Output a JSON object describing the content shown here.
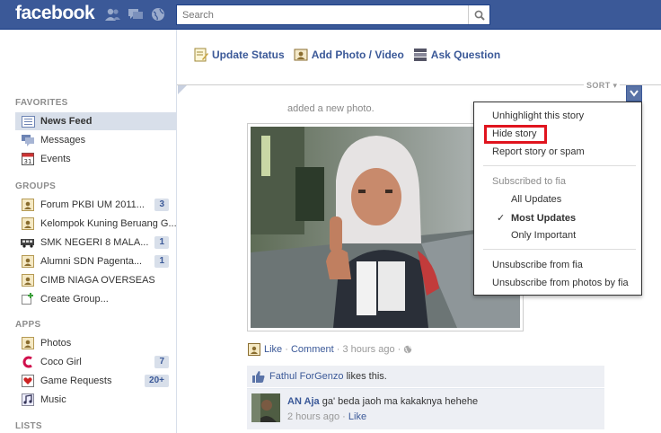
{
  "header": {
    "logo": "facebook",
    "search_placeholder": "Search"
  },
  "sidebar": {
    "favorites_title": "FAVORITES",
    "favorites": [
      {
        "label": "News Feed",
        "icon": "news-feed-icon",
        "selected": true
      },
      {
        "label": "Messages",
        "icon": "messages-icon"
      },
      {
        "label": "Events",
        "icon": "calendar-icon",
        "icon_text": "31"
      }
    ],
    "groups_title": "GROUPS",
    "groups": [
      {
        "label": "Forum PKBI UM 2011...",
        "badge": "3"
      },
      {
        "label": "Kelompok Kuning Beruang G...",
        "badge": ""
      },
      {
        "label": "SMK NEGERI 8 MALA...",
        "badge": "1"
      },
      {
        "label": "Alumni SDN Pagenta...",
        "badge": "1"
      },
      {
        "label": "CIMB NIAGA OVERSEAS",
        "badge": ""
      },
      {
        "label": "Create Group...",
        "badge": ""
      }
    ],
    "apps_title": "APPS",
    "apps": [
      {
        "label": "Photos",
        "badge": ""
      },
      {
        "label": "Coco Girl",
        "badge": "7"
      },
      {
        "label": "Game Requests",
        "badge": "20+"
      },
      {
        "label": "Music",
        "badge": ""
      }
    ],
    "lists_title": "LISTS"
  },
  "composer": {
    "update_status": "Update Status",
    "add_photo": "Add Photo / Video",
    "ask_question": "Ask Question"
  },
  "feed": {
    "sort_label": "SORT",
    "story_action": "added a new photo.",
    "like": "Like",
    "comment": "Comment",
    "sep": "·",
    "time": "3 hours ago",
    "liker": "Fathul ForGenzo",
    "likes_suffix": "likes this.",
    "comment_author": "AN Aja",
    "comment_text": "ga' beda jaoh ma kakaknya hehehe",
    "comment_time": "2 hours ago",
    "comment_like": "Like"
  },
  "menu": {
    "unhighlight": "Unhighlight this story",
    "hide": "Hide story",
    "report": "Report story or spam",
    "subscribed_header": "Subscribed to fia",
    "all_updates": "All Updates",
    "most_updates": "Most Updates",
    "only_important": "Only Important",
    "unsubscribe": "Unsubscribe from fia",
    "unsubscribe_photos": "Unsubscribe from photos by fia",
    "checkmark": "✓"
  },
  "colors": {
    "brand": "#3b5998",
    "highlight_box": "#e0141e",
    "selected_bg": "#d8dfea"
  }
}
